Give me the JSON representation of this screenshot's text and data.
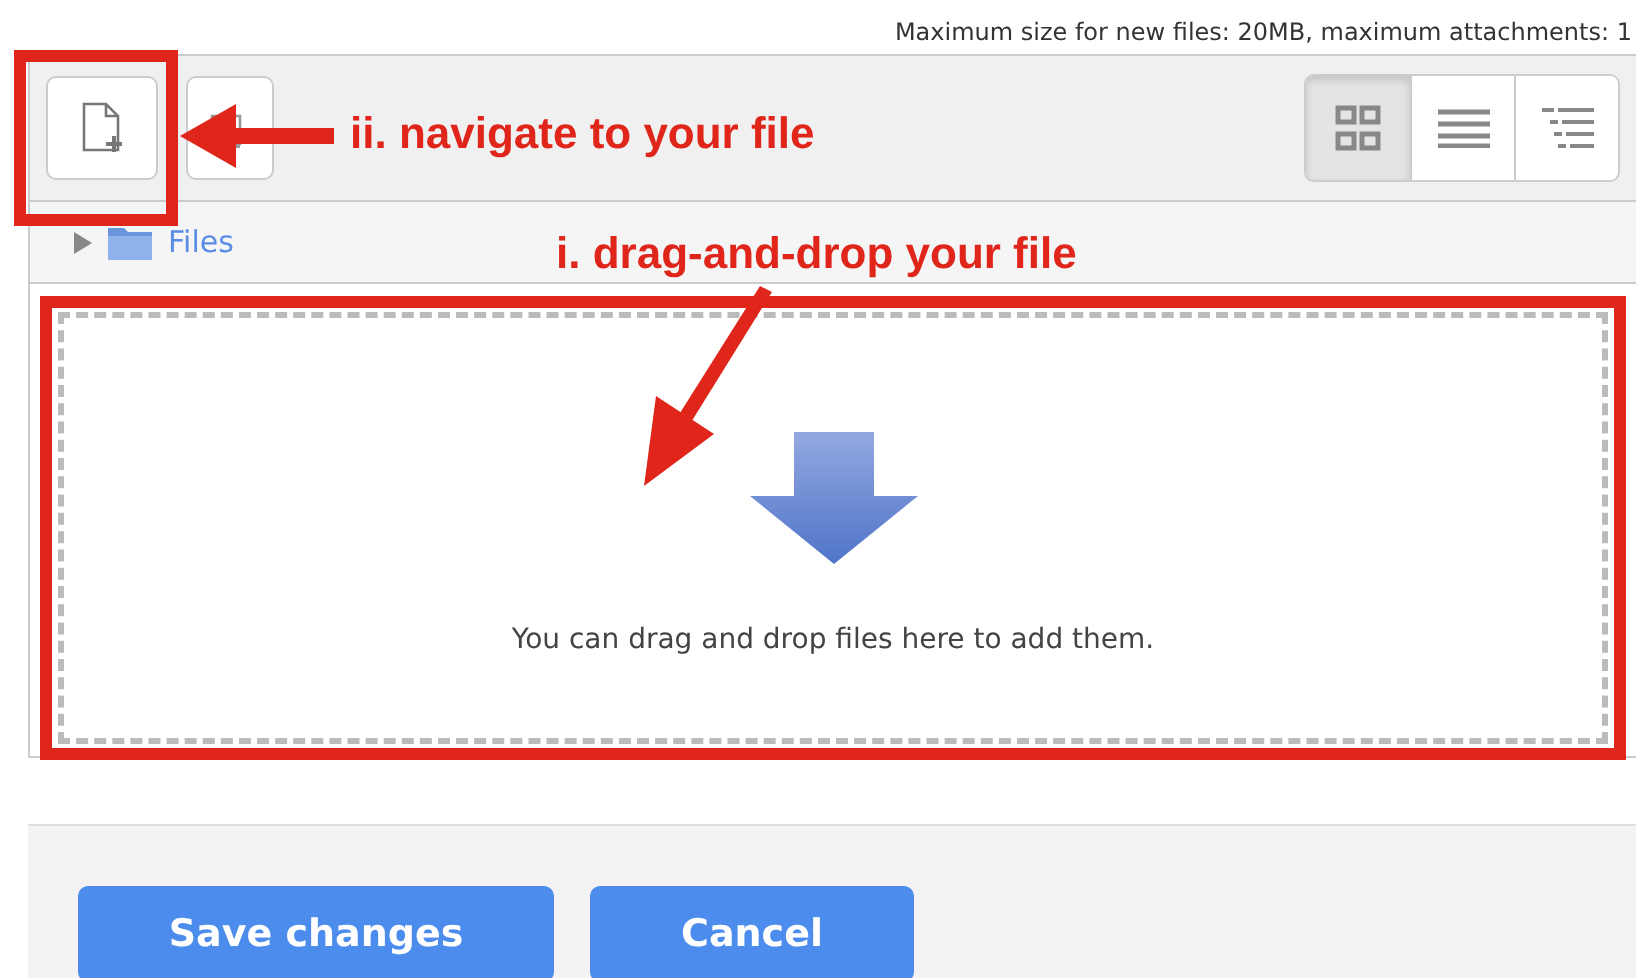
{
  "limits_note": "Maximum size for new files: 20MB, maximum attachments: 1",
  "toolbar": {
    "view_buttons": [
      {
        "kind": "icons",
        "selected": true
      },
      {
        "kind": "list",
        "selected": false
      },
      {
        "kind": "tree",
        "selected": false
      }
    ]
  },
  "path": {
    "folder": "Files"
  },
  "drop_zone": {
    "message": "You can drag and drop files here to add them."
  },
  "annotations": [
    {
      "text": "ii. navigate to your file"
    },
    {
      "text": "i. drag-and-drop your file"
    }
  ],
  "buttons": [
    {
      "label": "Save changes"
    },
    {
      "label": "Cancel"
    }
  ]
}
